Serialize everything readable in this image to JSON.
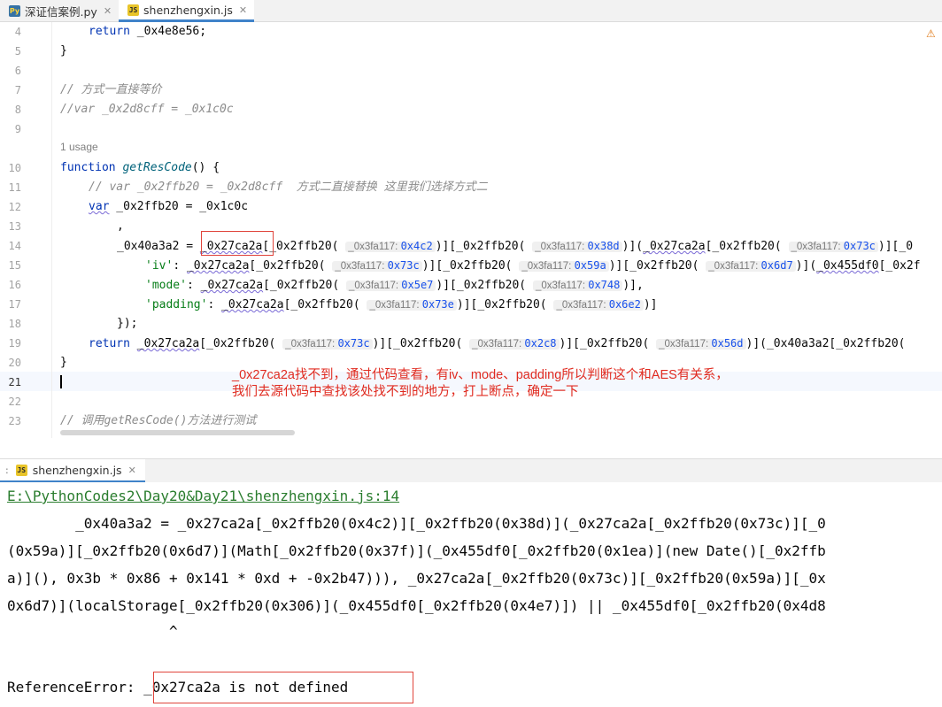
{
  "tabs": [
    {
      "label": "深证信案例.py",
      "icon": "python-file-icon"
    },
    {
      "label": "shenzhengxin.js",
      "icon": "js-file-icon"
    }
  ],
  "editor": {
    "line_numbers": [
      "4",
      "5",
      "6",
      "7",
      "8",
      "9",
      "10",
      "11",
      "12",
      "13",
      "14",
      "15",
      "16",
      "17",
      "18",
      "19",
      "20",
      "21",
      "22",
      "23"
    ],
    "usage": "1 usage",
    "warning_icon": "warning-icon",
    "annotation": [
      "_0x27ca2a找不到，通过代码查看，有iv、mode、padding所以判断这个和AES有关系，",
      "我们去源代码中查找该处找不到的地方，打上断点，确定一下"
    ],
    "code": {
      "l4": "return _0x4e8e56;",
      "l5": "}",
      "l7": "// 方式一直接等价",
      "l8": "//var _0x2d8cff = _0x1c0c",
      "l10_kw": "function",
      "l10_fn": "getResCode",
      "l10_rest": "() {",
      "l11": "// var _0x2ffb20 = _0x2d8cff  方式二直接替换 这里我们选择方式二",
      "l12_kw": "var",
      "l12_rest": " _0x2ffb20 = _0x1c0c",
      "l13": ",",
      "l14_a": "_0x40a3a2 = ",
      "l14_b": "_0x27ca2a",
      "l14_c": "[_0x2ffb20(",
      "l14_d": ")][_0x2ffb20(",
      "l14_e": ")](",
      "l14_f": "_0x27ca2a",
      "l14_g": "[_0x2ffb20(",
      "l14_h": ")][_0",
      "l15_st": "'iv'",
      "l15_a": ": ",
      "l15_b": "_0x27ca2a",
      "l15_c": "[_0x2ffb20(",
      "l15_d": ")][_0x2ffb20(",
      "l15_e": ")][_0x2ffb20(",
      "l15_f": ")](",
      "l15_g": "_0x455df0",
      "l15_h": "[_0x2f",
      "l16_st": "'mode'",
      "l16_a": ": ",
      "l16_b": "_0x27ca2a",
      "l16_c": "[_0x2ffb20(",
      "l16_d": ")][_0x2ffb20(",
      "l16_e": ")],",
      "l17_st": "'padding'",
      "l17_a": ": ",
      "l17_b": "_0x27ca2a",
      "l17_c": "[_0x2ffb20(",
      "l17_d": ")][_0x2ffb20(",
      "l17_e": ")]",
      "l18": "});",
      "l19_kw": "return",
      "l19_a": " ",
      "l19_b": "_0x27ca2a",
      "l19_c": "[_0x2ffb20(",
      "l19_d": ")][_0x2ffb20(",
      "l19_e": ")][_0x2ffb20(",
      "l19_f": ")](_0x40a3a2[_0x2ffb20(",
      "l20": "}",
      "l23": "// 调用getResCode()方法进行测试"
    },
    "hint_label": "_0x3fa117:",
    "hints": {
      "l14": [
        "0x4c2",
        "0x38d",
        "0x73c"
      ],
      "l15": [
        "0x73c",
        "0x59a",
        "0x6d7"
      ],
      "l16": [
        "0x5e7",
        "0x748"
      ],
      "l17": [
        "0x73e",
        "0x6e2"
      ],
      "l19": [
        "0x73c",
        "0x2c8",
        "0x56d"
      ]
    }
  },
  "run_panel": {
    "tab_label": "shenzhengxin.js",
    "tab_icon": "js-file-icon",
    "lines": [
      "E:\\PythonCodes2\\Day20&Day21\\shenzhengxin.js:14",
      "        _0x40a3a2 = _0x27ca2a[_0x2ffb20(0x4c2)][_0x2ffb20(0x38d)](_0x27ca2a[_0x2ffb20(0x73c)][_0",
      "(0x59a)][_0x2ffb20(0x6d7)](Math[_0x2ffb20(0x37f)](_0x455df0[_0x2ffb20(0x1ea)](new Date()[_0x2ffb",
      "a)](), 0x3b * 0x86 + 0x141 * 0xd + -0x2b47))), _0x27ca2a[_0x2ffb20(0x73c)][_0x2ffb20(0x59a)][_0x",
      "0x6d7)](localStorage[_0x2ffb20(0x306)](_0x455df0[_0x2ffb20(0x4e7)]) || _0x455df0[_0x2ffb20(0x4d8",
      "                   ^",
      "",
      "ReferenceError: _0x27ca2a is not defined"
    ]
  }
}
